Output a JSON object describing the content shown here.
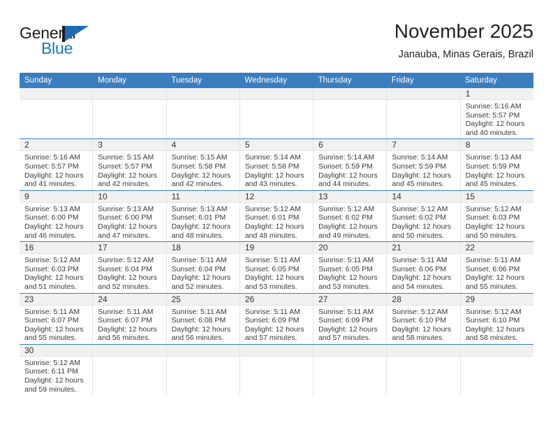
{
  "brand": {
    "name_top": "General",
    "name_bottom": "Blue",
    "accent_color": "#1878c8",
    "flag_color": "#1c6cb5"
  },
  "header": {
    "month_title": "November 2025",
    "location": "Janauba, Minas Gerais, Brazil"
  },
  "theme": {
    "header_bar_color": "#3a7ebf",
    "daynum_band_color": "#f1f1f1",
    "grid_line_color": "#e4e4e4"
  },
  "weekdays": [
    "Sunday",
    "Monday",
    "Tuesday",
    "Wednesday",
    "Thursday",
    "Friday",
    "Saturday"
  ],
  "weeks": [
    [
      {
        "day": "",
        "empty": true
      },
      {
        "day": "",
        "empty": true
      },
      {
        "day": "",
        "empty": true
      },
      {
        "day": "",
        "empty": true
      },
      {
        "day": "",
        "empty": true
      },
      {
        "day": "",
        "empty": true
      },
      {
        "day": "1",
        "sunrise": "Sunrise: 5:16 AM",
        "sunset": "Sunset: 5:57 PM",
        "daylight": "Daylight: 12 hours and 40 minutes."
      }
    ],
    [
      {
        "day": "2",
        "sunrise": "Sunrise: 5:16 AM",
        "sunset": "Sunset: 5:57 PM",
        "daylight": "Daylight: 12 hours and 41 minutes."
      },
      {
        "day": "3",
        "sunrise": "Sunrise: 5:15 AM",
        "sunset": "Sunset: 5:57 PM",
        "daylight": "Daylight: 12 hours and 42 minutes."
      },
      {
        "day": "4",
        "sunrise": "Sunrise: 5:15 AM",
        "sunset": "Sunset: 5:58 PM",
        "daylight": "Daylight: 12 hours and 42 minutes."
      },
      {
        "day": "5",
        "sunrise": "Sunrise: 5:14 AM",
        "sunset": "Sunset: 5:58 PM",
        "daylight": "Daylight: 12 hours and 43 minutes."
      },
      {
        "day": "6",
        "sunrise": "Sunrise: 5:14 AM",
        "sunset": "Sunset: 5:59 PM",
        "daylight": "Daylight: 12 hours and 44 minutes."
      },
      {
        "day": "7",
        "sunrise": "Sunrise: 5:14 AM",
        "sunset": "Sunset: 5:59 PM",
        "daylight": "Daylight: 12 hours and 45 minutes."
      },
      {
        "day": "8",
        "sunrise": "Sunrise: 5:13 AM",
        "sunset": "Sunset: 5:59 PM",
        "daylight": "Daylight: 12 hours and 45 minutes."
      }
    ],
    [
      {
        "day": "9",
        "sunrise": "Sunrise: 5:13 AM",
        "sunset": "Sunset: 6:00 PM",
        "daylight": "Daylight: 12 hours and 46 minutes."
      },
      {
        "day": "10",
        "sunrise": "Sunrise: 5:13 AM",
        "sunset": "Sunset: 6:00 PM",
        "daylight": "Daylight: 12 hours and 47 minutes."
      },
      {
        "day": "11",
        "sunrise": "Sunrise: 5:13 AM",
        "sunset": "Sunset: 6:01 PM",
        "daylight": "Daylight: 12 hours and 48 minutes."
      },
      {
        "day": "12",
        "sunrise": "Sunrise: 5:12 AM",
        "sunset": "Sunset: 6:01 PM",
        "daylight": "Daylight: 12 hours and 48 minutes."
      },
      {
        "day": "13",
        "sunrise": "Sunrise: 5:12 AM",
        "sunset": "Sunset: 6:02 PM",
        "daylight": "Daylight: 12 hours and 49 minutes."
      },
      {
        "day": "14",
        "sunrise": "Sunrise: 5:12 AM",
        "sunset": "Sunset: 6:02 PM",
        "daylight": "Daylight: 12 hours and 50 minutes."
      },
      {
        "day": "15",
        "sunrise": "Sunrise: 5:12 AM",
        "sunset": "Sunset: 6:03 PM",
        "daylight": "Daylight: 12 hours and 50 minutes."
      }
    ],
    [
      {
        "day": "16",
        "sunrise": "Sunrise: 5:12 AM",
        "sunset": "Sunset: 6:03 PM",
        "daylight": "Daylight: 12 hours and 51 minutes."
      },
      {
        "day": "17",
        "sunrise": "Sunrise: 5:12 AM",
        "sunset": "Sunset: 6:04 PM",
        "daylight": "Daylight: 12 hours and 52 minutes."
      },
      {
        "day": "18",
        "sunrise": "Sunrise: 5:11 AM",
        "sunset": "Sunset: 6:04 PM",
        "daylight": "Daylight: 12 hours and 52 minutes."
      },
      {
        "day": "19",
        "sunrise": "Sunrise: 5:11 AM",
        "sunset": "Sunset: 6:05 PM",
        "daylight": "Daylight: 12 hours and 53 minutes."
      },
      {
        "day": "20",
        "sunrise": "Sunrise: 5:11 AM",
        "sunset": "Sunset: 6:05 PM",
        "daylight": "Daylight: 12 hours and 53 minutes."
      },
      {
        "day": "21",
        "sunrise": "Sunrise: 5:11 AM",
        "sunset": "Sunset: 6:06 PM",
        "daylight": "Daylight: 12 hours and 54 minutes."
      },
      {
        "day": "22",
        "sunrise": "Sunrise: 5:11 AM",
        "sunset": "Sunset: 6:06 PM",
        "daylight": "Daylight: 12 hours and 55 minutes."
      }
    ],
    [
      {
        "day": "23",
        "sunrise": "Sunrise: 5:11 AM",
        "sunset": "Sunset: 6:07 PM",
        "daylight": "Daylight: 12 hours and 55 minutes."
      },
      {
        "day": "24",
        "sunrise": "Sunrise: 5:11 AM",
        "sunset": "Sunset: 6:07 PM",
        "daylight": "Daylight: 12 hours and 56 minutes."
      },
      {
        "day": "25",
        "sunrise": "Sunrise: 5:11 AM",
        "sunset": "Sunset: 6:08 PM",
        "daylight": "Daylight: 12 hours and 56 minutes."
      },
      {
        "day": "26",
        "sunrise": "Sunrise: 5:11 AM",
        "sunset": "Sunset: 6:09 PM",
        "daylight": "Daylight: 12 hours and 57 minutes."
      },
      {
        "day": "27",
        "sunrise": "Sunrise: 5:11 AM",
        "sunset": "Sunset: 6:09 PM",
        "daylight": "Daylight: 12 hours and 57 minutes."
      },
      {
        "day": "28",
        "sunrise": "Sunrise: 5:12 AM",
        "sunset": "Sunset: 6:10 PM",
        "daylight": "Daylight: 12 hours and 58 minutes."
      },
      {
        "day": "29",
        "sunrise": "Sunrise: 5:12 AM",
        "sunset": "Sunset: 6:10 PM",
        "daylight": "Daylight: 12 hours and 58 minutes."
      }
    ],
    [
      {
        "day": "30",
        "sunrise": "Sunrise: 5:12 AM",
        "sunset": "Sunset: 6:11 PM",
        "daylight": "Daylight: 12 hours and 59 minutes."
      },
      {
        "day": "",
        "empty": true
      },
      {
        "day": "",
        "empty": true
      },
      {
        "day": "",
        "empty": true
      },
      {
        "day": "",
        "empty": true
      },
      {
        "day": "",
        "empty": true
      },
      {
        "day": "",
        "empty": true
      }
    ]
  ]
}
